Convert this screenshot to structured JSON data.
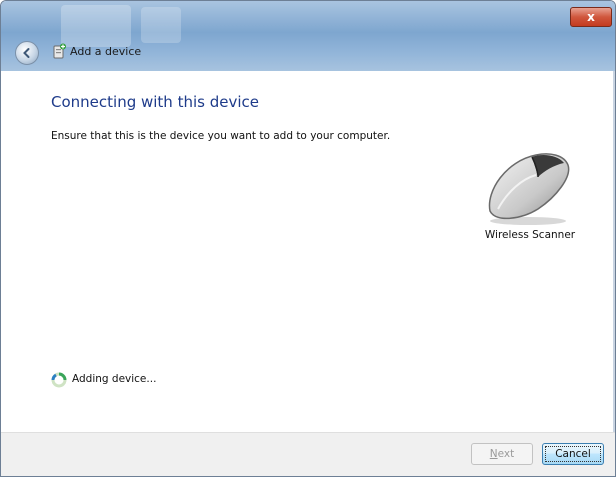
{
  "window": {
    "title": "Add a device",
    "close_label": "x"
  },
  "icons": {
    "back": "back-arrow-icon",
    "title": "add-device-icon",
    "device": "mouse-icon",
    "status": "progress-spinner-icon"
  },
  "main": {
    "heading": "Connecting with this device",
    "instruction": "Ensure that this is the device you want to add to your computer.",
    "device": {
      "name": "Wireless Scanner"
    },
    "status": "Adding device..."
  },
  "footer": {
    "next_label_accel": "N",
    "next_label_rest": "ext",
    "next_enabled": false,
    "cancel_label": "Cancel"
  },
  "colors": {
    "heading": "#1e3b8a",
    "titlebar": "#7ea6cf",
    "close": "#c43b1f"
  }
}
